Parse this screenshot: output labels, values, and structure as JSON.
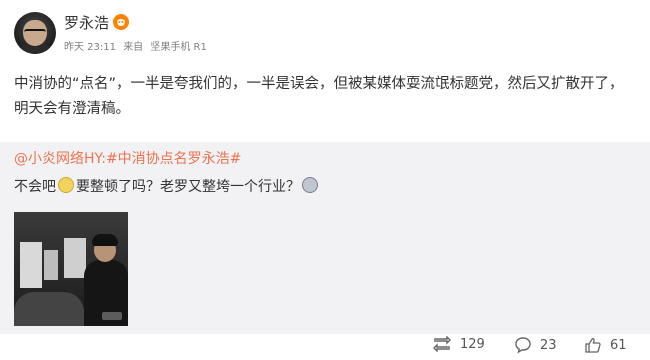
{
  "author": {
    "name": "罗永浩",
    "badge_color": "#ff8200"
  },
  "meta": {
    "time": "昨天 23:11",
    "source_prefix": "来自",
    "source": "坚果手机 R1"
  },
  "post": {
    "text": "中消协的“点名”，一半是夸我们的，一半是误会，但被某媒体耍流氓标题党，然后又扩散开了，明天会有澄清稿。"
  },
  "repost": {
    "mention": "@小炎网络HY:",
    "hashtag": "#中消协点名罗永浩#",
    "text_part1": "不会吧",
    "text_part2": "要整顿了吗？老罗又整垮一个行业？",
    "emoji1": "doge-emoji",
    "emoji2": "eye-emoji"
  },
  "actions": {
    "repost_count": "129",
    "comment_count": "23",
    "like_count": "61"
  },
  "colors": {
    "link": "#eb7350",
    "repost_bg": "#f2f2f5"
  }
}
